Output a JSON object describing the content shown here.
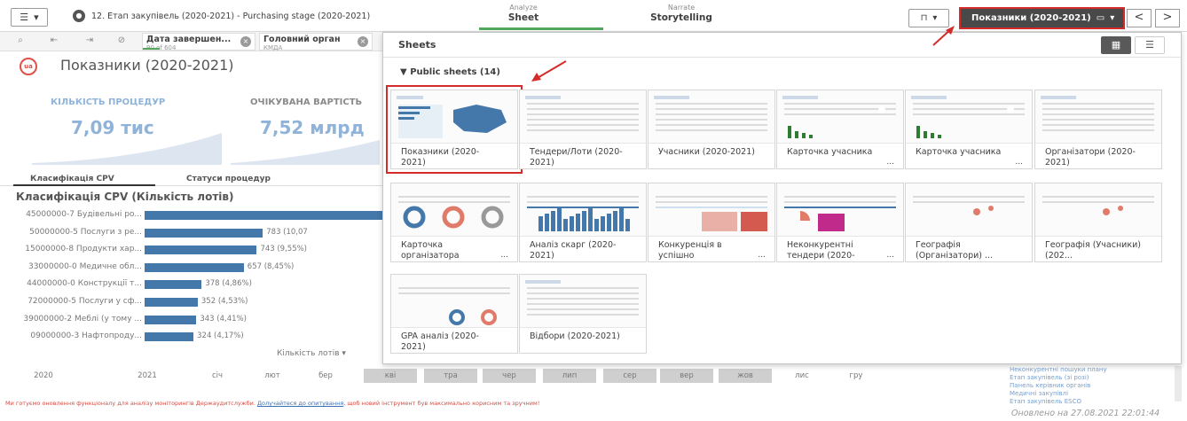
{
  "toolbar": {
    "app_title": "12. Етап закупівель (2020-2021) - Purchasing stage (2020-2021)",
    "tabs": [
      {
        "small": "Analyze",
        "big": "Sheet"
      },
      {
        "small": "Narrate",
        "big": "Storytelling"
      }
    ],
    "current_sheet": "Показники (2020-2021)",
    "bookmark_icon": "bookmark-icon",
    "prev": "<",
    "next": ">"
  },
  "selections": [
    {
      "title": "Дата завершен...",
      "sub": "90 of 604",
      "progress": 0.15
    },
    {
      "title": "Головний орган",
      "sub": "КМДА"
    }
  ],
  "sheet": {
    "title": "Показники (2020-2021)",
    "kpis": [
      {
        "label": "КІЛЬКІСТЬ ПРОЦЕДУР",
        "value": "7,09 тис"
      },
      {
        "label": "ОЧІКУВАНА ВАРТІСТЬ",
        "value": "7,52 млрд"
      }
    ],
    "subtabs": [
      "Класифікація CPV",
      "Статуси процедур"
    ],
    "cpv_title": "Класифікація CPV (Кількість лотів)",
    "cpv_rows": [
      {
        "label": "45000000-7 Будівельні ро...",
        "value": 1650,
        "text": ""
      },
      {
        "label": "50000000-5 Послуги з ре...",
        "value": 783,
        "text": "783 (10,07"
      },
      {
        "label": "15000000-8 Продукти хар...",
        "value": 743,
        "text": "743 (9,55%)"
      },
      {
        "label": "33000000-0 Медичне обл...",
        "value": 657,
        "text": "657 (8,45%)"
      },
      {
        "label": "44000000-0 Конструкції т...",
        "value": 378,
        "text": "378 (4,86%)"
      },
      {
        "label": "72000000-5 Послуги у сф...",
        "value": 352,
        "text": "352 (4,53%)"
      },
      {
        "label": "39000000-2 Меблі (у тому ...",
        "value": 343,
        "text": "343 (4,41%)"
      },
      {
        "label": "09000000-3 Нафтопроду...",
        "value": 324,
        "text": "324 (4,17%)"
      }
    ],
    "cpv_measure": "Кількість лотів",
    "timeline": [
      "2020",
      "2021",
      "січ",
      "лют",
      "бер",
      "кві",
      "тра",
      "чер",
      "лип",
      "сер",
      "вер",
      "жов",
      "лис",
      "гру"
    ],
    "footer_pre": "Ми готуємо оновлення функціоналу для аналізу моніторингів Держаудитслужби. ",
    "footer_link": "Долучайтеся до опитування",
    "footer_post": ", щоб новий інструмент був максимально корисним та зручним!",
    "side_links": [
      "Неконкурентні пошуки плану",
      "Етап закупівель (зі розі)",
      "Панель керівник органів",
      "Медичні закупівлі",
      "Етап закупівель ESCO"
    ],
    "updated": "Оновлено на 27.08.2021 22:01:44"
  },
  "popover": {
    "title": "Sheets",
    "section": "Public sheets (14)",
    "cards": [
      {
        "caption": "Показники (2020-2021)",
        "more": ""
      },
      {
        "caption": "Тендери/Лоти (2020-2021)",
        "more": ""
      },
      {
        "caption": "Учасники (2020-2021)",
        "more": ""
      },
      {
        "caption": "Карточка учасника",
        "more": "..."
      },
      {
        "caption": "Карточка учасника",
        "more": "..."
      },
      {
        "caption": "Організатори (2020-2021)",
        "more": ""
      },
      {
        "caption": "Карточка організатора",
        "more": "..."
      },
      {
        "caption": "Аналіз скарг (2020-2021)",
        "more": ""
      },
      {
        "caption": "Конкуренція в успішно",
        "more": "..."
      },
      {
        "caption": "Неконкурентні тендери (2020-",
        "more": "..."
      },
      {
        "caption": "Географія (Організатори) ...",
        "more": ""
      },
      {
        "caption": "Географія (Учасники) (202...",
        "more": ""
      },
      {
        "caption": "GPA аналіз (2020-2021)",
        "more": ""
      },
      {
        "caption": "Відбори (2020-2021)",
        "more": ""
      }
    ]
  },
  "colors": {
    "accent": "#52a95b",
    "highlight": "#d42b2b",
    "bar": "#4477aa"
  }
}
